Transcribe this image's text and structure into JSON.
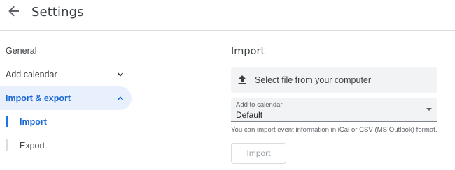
{
  "header": {
    "back_icon": "arrow-back-icon",
    "title": "Settings"
  },
  "sidebar": {
    "items": [
      {
        "label": "General"
      },
      {
        "label": "Add calendar",
        "icon": "chevron-down-icon"
      },
      {
        "label": "Import & export",
        "icon": "chevron-up-icon",
        "active": true
      }
    ],
    "sub_items": [
      {
        "label": "Import",
        "active": true
      },
      {
        "label": "Export"
      }
    ]
  },
  "main": {
    "section_title": "Import",
    "file_button": {
      "icon": "upload-icon",
      "label": "Select file from your computer"
    },
    "calendar_select": {
      "caption": "Add to calendar",
      "value": "Default"
    },
    "help_text": "You can import event information in iCal or CSV (MS Outlook) format.",
    "import_button_label": "Import"
  },
  "colors": {
    "accent": "#1a73e8",
    "active_bg": "#e8f0fe",
    "field_bg": "#f1f3f4"
  }
}
